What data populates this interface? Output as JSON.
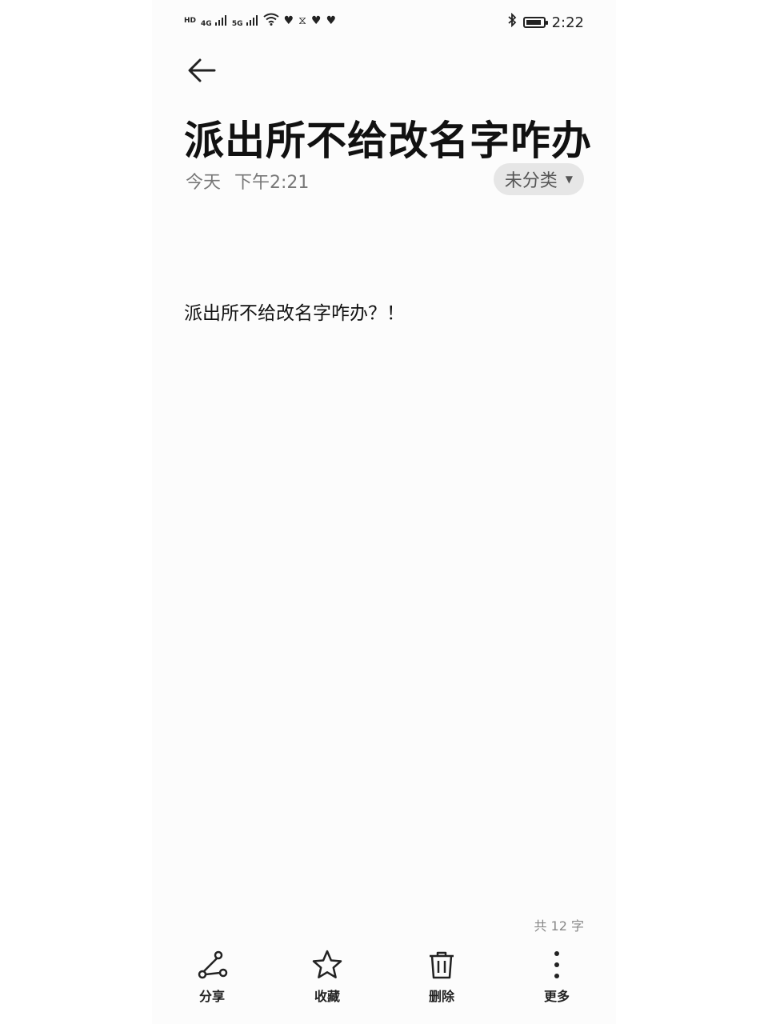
{
  "status_bar": {
    "time": "2:22",
    "left_icons": [
      "hd-icon",
      "4g-signal-icon",
      "5g-signal-icon",
      "wifi-icon",
      "heart-icon",
      "hourglass-icon",
      "heart-icon",
      "heart-icon"
    ],
    "network_4g": "4G",
    "network_5g": "5G",
    "hd_label": "HD",
    "right_icons": [
      "bluetooth-icon",
      "battery-icon"
    ]
  },
  "note": {
    "title": "派出所不给改名字咋办",
    "date": "今天",
    "time": "下午2:21",
    "category": "未分类",
    "body": "派出所不给改名字咋办？！",
    "word_count": "共 12 字"
  },
  "toolbar": {
    "share_label": "分享",
    "favorite_label": "收藏",
    "delete_label": "删除",
    "more_label": "更多"
  }
}
